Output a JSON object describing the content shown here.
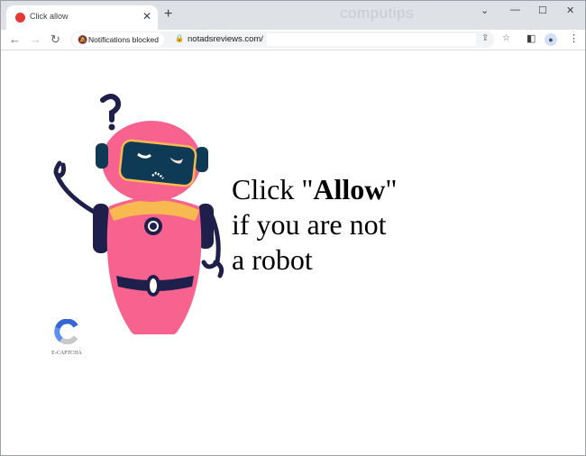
{
  "browser": {
    "tab": {
      "title": "Click allow",
      "favicon": "red-circle-icon"
    },
    "new_tab_label": "+",
    "watermark": "computips",
    "window_controls": {
      "dropdown": "⌄",
      "minimize": "—",
      "maximize": "☐",
      "close": "✕"
    },
    "nav": {
      "back": "←",
      "forward": "→",
      "reload": "↻"
    },
    "notification_chip": "Notifications blocked",
    "url": "notadsreviews.com/",
    "icons": {
      "share": "⇪",
      "bookmark": "☆",
      "sidepanel": "◧",
      "profile": "👤",
      "menu": "⋮"
    }
  },
  "page": {
    "headline_pre": "Click \"",
    "headline_bold": "Allow",
    "headline_post": "\"",
    "line2": "if you are not",
    "line3": "a robot",
    "captcha_label": "E-CAPTCHA",
    "colors": {
      "robot_body": "#f7638e",
      "robot_dark": "#1e1f4b",
      "visor": "#0f3a55",
      "collar": "#f7b950"
    }
  }
}
